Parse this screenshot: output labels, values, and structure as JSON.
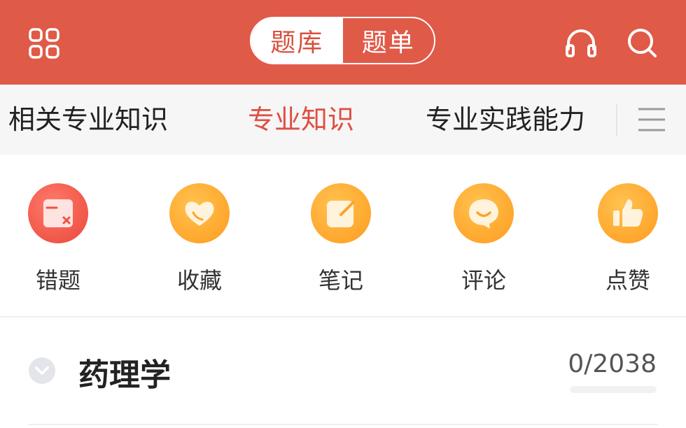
{
  "header": {
    "segments": [
      {
        "label": "题库",
        "active": true
      },
      {
        "label": "题单",
        "active": false
      }
    ],
    "icons": {
      "left": "grid-icon",
      "right": [
        "headphones-icon",
        "search-icon"
      ]
    }
  },
  "subject_tabs": [
    {
      "label": "相关专业知识",
      "active": false
    },
    {
      "label": "专业知识",
      "active": true
    },
    {
      "label": "专业实践能力",
      "active": false
    }
  ],
  "shortcuts": [
    {
      "label": "错题",
      "icon": "wrong-questions-icon"
    },
    {
      "label": "收藏",
      "icon": "heart-icon"
    },
    {
      "label": "笔记",
      "icon": "note-icon"
    },
    {
      "label": "评论",
      "icon": "comment-icon"
    },
    {
      "label": "点赞",
      "icon": "thumbs-up-icon"
    }
  ],
  "chapter": {
    "title": "药理学",
    "progress_text": "0/2038",
    "progress_fraction": 0
  },
  "colors": {
    "brand_red": "#e05a48",
    "active_tab": "#dd5042",
    "orange": "#ffa22a",
    "red_icon": "#ef5243"
  }
}
